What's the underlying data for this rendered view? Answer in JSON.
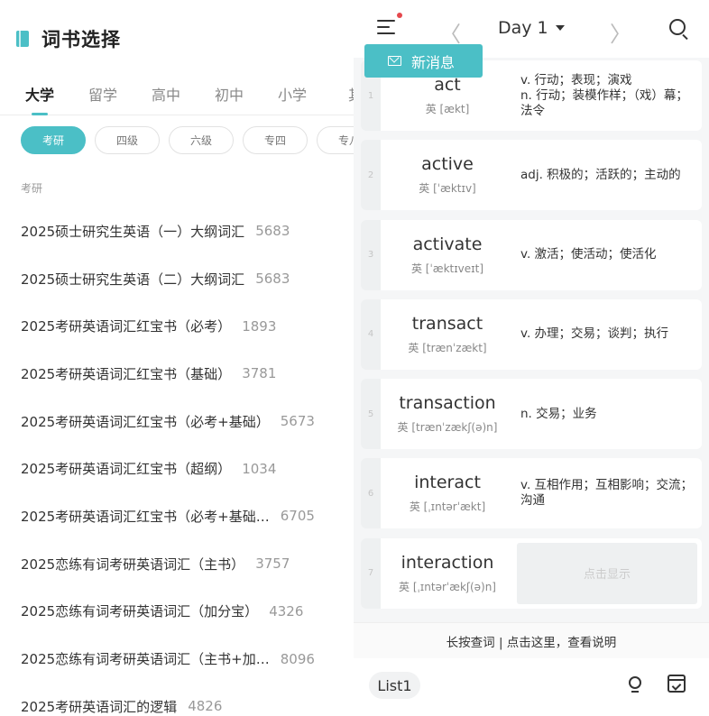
{
  "left": {
    "title": "词书选择",
    "level_tabs": [
      "大学",
      "留学",
      "高中",
      "初中",
      "小学",
      "其"
    ],
    "active_level": 0,
    "chips": [
      "考研",
      "四级",
      "六级",
      "专四",
      "专八"
    ],
    "active_chip": 0,
    "section_label": "考研",
    "books": [
      {
        "name": "2025硕士研究生英语（一）大纲词汇",
        "count": "5683"
      },
      {
        "name": "2025硕士研究生英语（二）大纲词汇",
        "count": "5683"
      },
      {
        "name": "2025考研英语词汇红宝书（必考）",
        "count": "1893"
      },
      {
        "name": "2025考研英语词汇红宝书（基础）",
        "count": "3781"
      },
      {
        "name": "2025考研英语词汇红宝书（必考+基础）",
        "count": "5673"
      },
      {
        "name": "2025考研英语词汇红宝书（超纲）",
        "count": "1034"
      },
      {
        "name": "2025考研英语词汇红宝书（必考+基础…",
        "count": "6705"
      },
      {
        "name": "2025恋练有词考研英语词汇（主书）",
        "count": "3757"
      },
      {
        "name": "2025恋练有词考研英语词汇（加分宝）",
        "count": "4326"
      },
      {
        "name": "2025恋练有词考研英语词汇（主书+加…",
        "count": "8096"
      },
      {
        "name": "2025考研英语词汇的逻辑",
        "count": "4826"
      }
    ]
  },
  "right": {
    "day_label": "Day 1",
    "nav_prev": "〈",
    "nav_next": "〉",
    "message_banner": "新消息",
    "words": [
      {
        "index": "1",
        "word": "act",
        "phonetic": "英 [ækt]",
        "definition": "v. 行动；表现；演戏\nn. 行动；装模作样；（戏）幕；法令"
      },
      {
        "index": "2",
        "word": "active",
        "phonetic": "英 [ˈæktɪv]",
        "definition": "adj. 积极的；活跃的；主动的"
      },
      {
        "index": "3",
        "word": "activate",
        "phonetic": "英 [ˈæktɪveɪt]",
        "definition": "v. 激活；使活动；使活化"
      },
      {
        "index": "4",
        "word": "transact",
        "phonetic": "英 [trænˈzækt]",
        "definition": "v. 办理；交易；谈判；执行"
      },
      {
        "index": "5",
        "word": "transaction",
        "phonetic": "英 [trænˈzækʃ(ə)n]",
        "definition": "n. 交易；业务"
      },
      {
        "index": "6",
        "word": "interact",
        "phonetic": "英 [ˌɪntərˈækt]",
        "definition": "v. 互相作用；互相影响；交流；沟通"
      },
      {
        "index": "7",
        "word": "interaction",
        "phonetic": "英 [ˌɪntərˈækʃ(ə)n]",
        "definition": "",
        "hidden_label": "点击显示"
      }
    ],
    "hint": "长按查词 | 点击这里，查看说明",
    "list_button": "List1"
  }
}
